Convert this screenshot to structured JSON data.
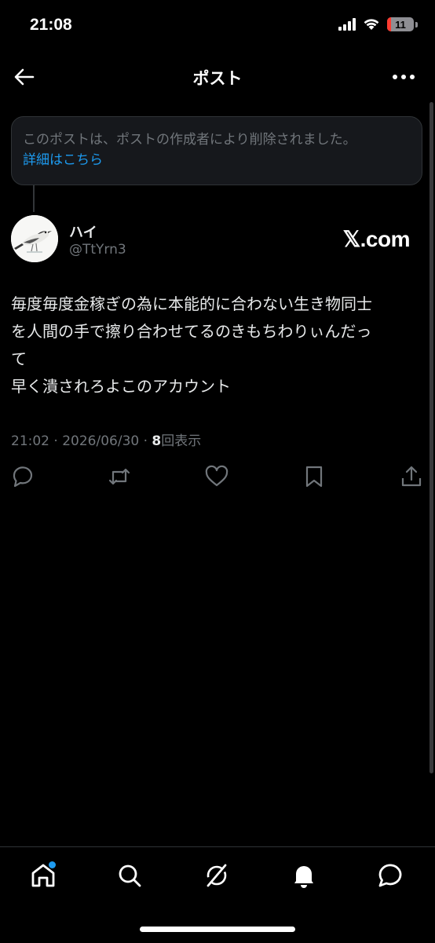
{
  "status_bar": {
    "time": "21:08",
    "battery": "11"
  },
  "header": {
    "title": "ポスト"
  },
  "deleted_notice": {
    "text": "このポストは、ポストの作成者により削除されました。",
    "link": "詳細はこちら"
  },
  "author": {
    "name": "ハイ",
    "handle": "@TtYrn3"
  },
  "watermark": "𝕏.com",
  "post": {
    "lines": [
      "毎度毎度金稼ぎの為に本能的に合わない生き物同士",
      "を人間の手で擦り合わせてるのきもちわりぃんだっ",
      "て",
      "早く潰されろよこのアカウント"
    ],
    "time": "21:02",
    "separator": "·",
    "date": "2026/06/30",
    "views_count": "8",
    "views_label": "回表示"
  },
  "actions": [
    "reply-icon",
    "repost-icon",
    "like-icon",
    "bookmark-icon",
    "share-icon"
  ],
  "nav": [
    "home-icon",
    "search-icon",
    "grok-icon",
    "notifications-icon",
    "messages-icon"
  ],
  "colors": {
    "accent": "#1d9bf0",
    "muted": "#71767b",
    "background": "#000000"
  }
}
